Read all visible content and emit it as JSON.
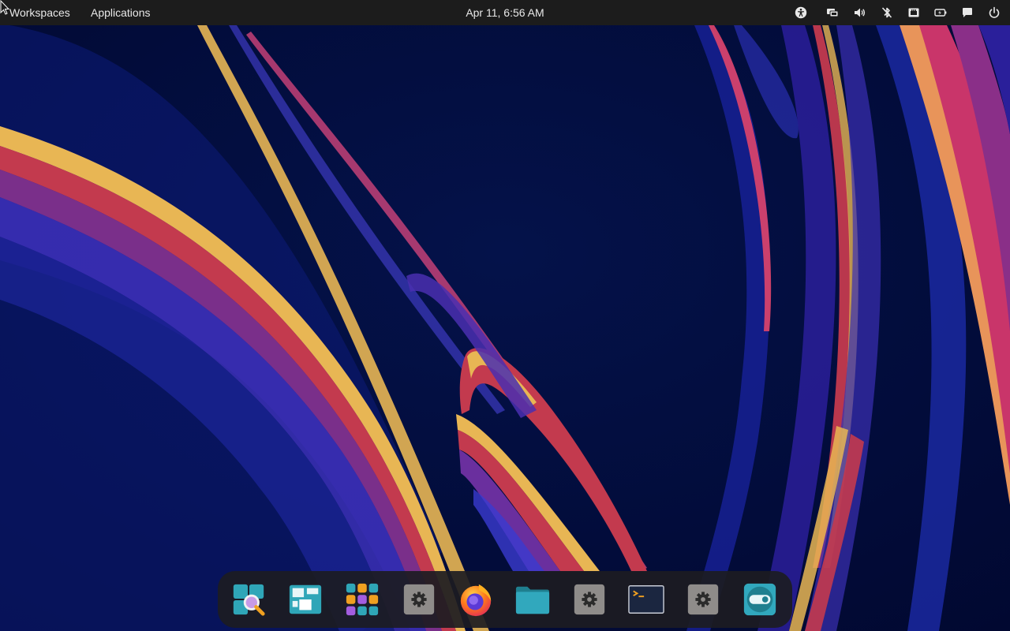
{
  "top_panel": {
    "workspaces_label": "Workspaces",
    "applications_label": "Applications",
    "clock": "Apr 11, 6:56 AM",
    "tray": [
      {
        "icon": "accessibility-icon"
      },
      {
        "icon": "display-icon"
      },
      {
        "icon": "volume-icon"
      },
      {
        "icon": "bluetooth-off-icon"
      },
      {
        "icon": "network-wired-icon"
      },
      {
        "icon": "battery-icon"
      },
      {
        "icon": "notifications-icon"
      },
      {
        "icon": "power-icon"
      }
    ]
  },
  "dock": {
    "items": [
      {
        "icon": "search-app-icon"
      },
      {
        "icon": "workspaces-app-icon"
      },
      {
        "icon": "app-grid-icon"
      },
      {
        "icon": "settings-app-icon"
      },
      {
        "icon": "firefox-icon"
      },
      {
        "icon": "files-folder-icon"
      },
      {
        "icon": "settings-app-icon"
      },
      {
        "icon": "terminal-icon"
      },
      {
        "icon": "settings-app-icon"
      },
      {
        "icon": "toggle-settings-app-icon"
      }
    ]
  },
  "colors": {
    "panel_bg": "#1c1c1c",
    "dock_bg": "#1c1c22",
    "wallpaper_base": "#020a3a",
    "accent_teal": "#31a8bd"
  }
}
